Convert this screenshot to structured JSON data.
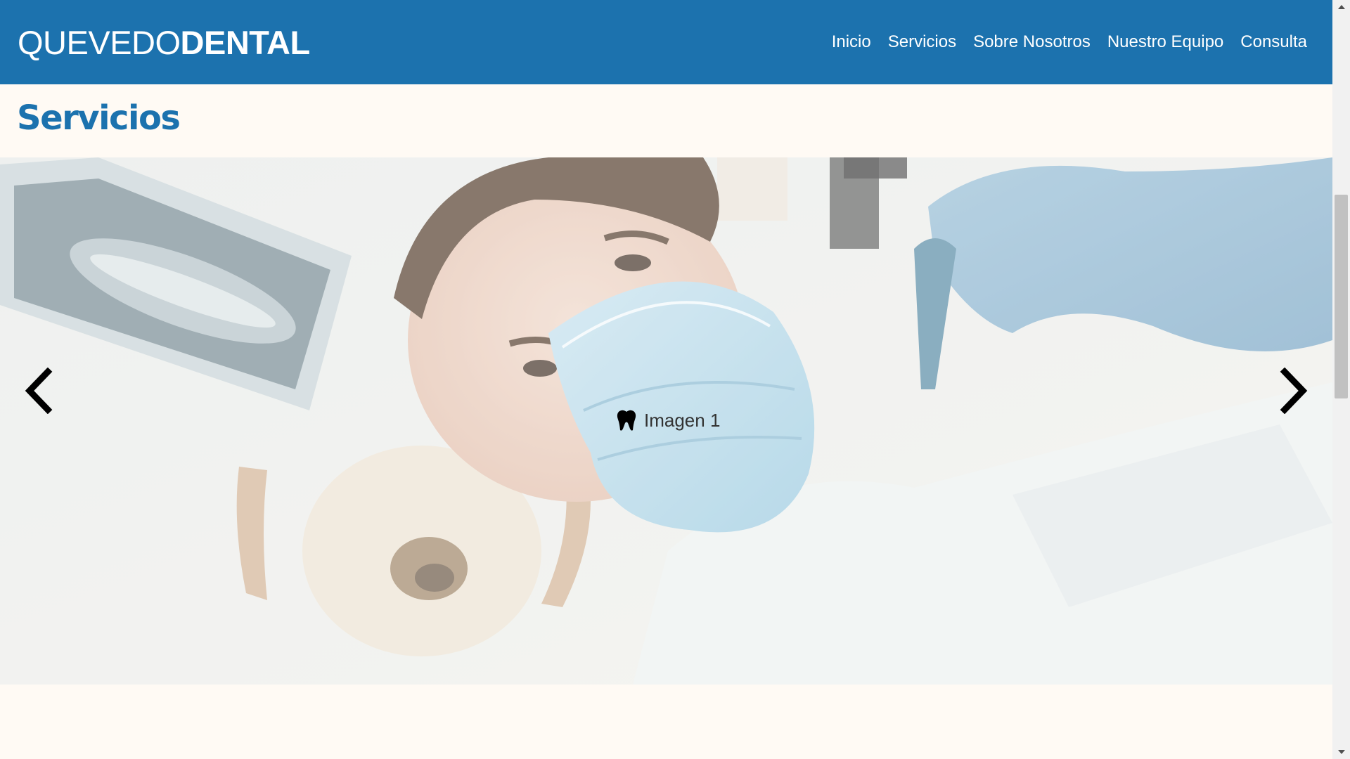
{
  "header": {
    "logo_light": "QUEVEDO",
    "logo_bold": "DENTAL",
    "nav": [
      {
        "label": "Inicio"
      },
      {
        "label": "Servicios"
      },
      {
        "label": "Sobre Nosotros"
      },
      {
        "label": "Nuestro Equipo"
      },
      {
        "label": "Consulta"
      }
    ]
  },
  "section": {
    "title": "Servicios"
  },
  "carousel": {
    "caption": "Imagen 1",
    "caption_icon": "tooth-icon",
    "prev_icon": "chevron-left-icon",
    "next_icon": "chevron-right-icon"
  },
  "colors": {
    "brand": "#1c72ae",
    "background": "#fffaf4",
    "nav_text": "#ffffff"
  }
}
